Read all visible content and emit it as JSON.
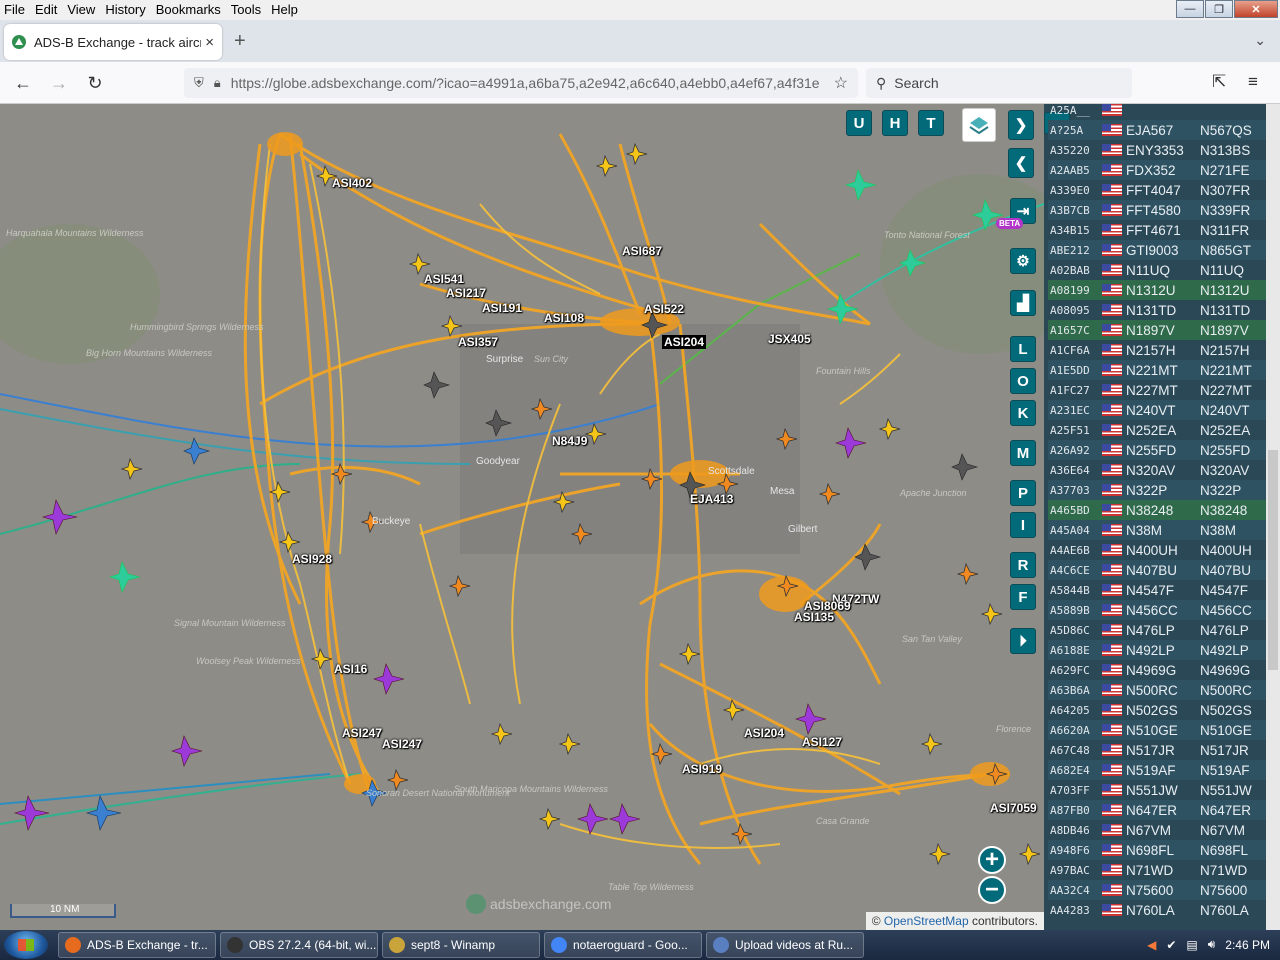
{
  "menubar": {
    "items": [
      "File",
      "Edit",
      "View",
      "History",
      "Bookmarks",
      "Tools",
      "Help"
    ]
  },
  "tab": {
    "title": "ADS-B Exchange - track aircraft",
    "close": "×"
  },
  "newtab": "+",
  "url": "https://globe.adsbexchange.com/?icao=a4991a,a6ba75,a2e942,a6c640,a4ebb0,a4ef67,a4f31e",
  "search_placeholder": "Search",
  "map": {
    "buttons": [
      "U",
      "H",
      "T",
      "L",
      "O",
      "K",
      "M",
      "P",
      "I",
      "R",
      "F"
    ],
    "beta": "BETA",
    "scale": "10 NM",
    "watermark": "adsbexchange.com",
    "attribution_prefix": "© ",
    "attribution_link": "OpenStreetMap",
    "attribution_suffix": " contributors.",
    "labels": [
      {
        "text": "ASI402"
      },
      {
        "text": "ASI541"
      },
      {
        "text": "ASI217"
      },
      {
        "text": "ASI191"
      },
      {
        "text": "ASI108"
      },
      {
        "text": "ASI687"
      },
      {
        "text": "ASI522"
      },
      {
        "text": "ASI357"
      },
      {
        "text": "ASI204"
      },
      {
        "text": "JSX405"
      },
      {
        "text": "N84J9"
      },
      {
        "text": "EJA413"
      },
      {
        "text": "ASI928"
      },
      {
        "text": "N472TW"
      },
      {
        "text": "ASI8069"
      },
      {
        "text": "ASI135"
      },
      {
        "text": "ASI16"
      },
      {
        "text": "ASI247"
      },
      {
        "text": "ASI247"
      },
      {
        "text": "ASI204"
      },
      {
        "text": "ASI127"
      },
      {
        "text": "ASI919"
      },
      {
        "text": "ASI7059"
      }
    ],
    "places": [
      {
        "text": "Harquahala Mountains Wilderness"
      },
      {
        "text": "Tonto National Forest"
      },
      {
        "text": "Surprise"
      },
      {
        "text": "Sun City"
      },
      {
        "text": "Goodyear"
      },
      {
        "text": "Buckeye"
      },
      {
        "text": "Scottsdale"
      },
      {
        "text": "Mesa"
      },
      {
        "text": "Gilbert"
      },
      {
        "text": "Fountain Hills"
      },
      {
        "text": "Apache Junction"
      },
      {
        "text": "San Tan Valley"
      },
      {
        "text": "Woolsey Peak Wilderness"
      },
      {
        "text": "Sonoran Desert National Monument"
      },
      {
        "text": "South Maricopa Mountains Wilderness"
      },
      {
        "text": "Florence"
      },
      {
        "text": "Table Top Wilderness"
      },
      {
        "text": "Casa Grande"
      },
      {
        "text": "Hummingbird Springs Wilderness"
      },
      {
        "text": "Signal Mountain Wilderness"
      },
      {
        "text": "Big Horn Mountains Wilderness"
      }
    ]
  },
  "aircraft_list": [
    {
      "hex": "A25A__",
      "callsign": "",
      "reg": ""
    },
    {
      "hex": "A?25A",
      "callsign": "EJA567",
      "reg": "N567QS"
    },
    {
      "hex": "A35220",
      "callsign": "ENY3353",
      "reg": "N313BS"
    },
    {
      "hex": "A2AAB5",
      "callsign": "FDX352",
      "reg": "N271FE"
    },
    {
      "hex": "A339E0",
      "callsign": "FFT4047",
      "reg": "N307FR"
    },
    {
      "hex": "A3B7CB",
      "callsign": "FFT4580",
      "reg": "N339FR"
    },
    {
      "hex": "A34B15",
      "callsign": "FFT4671",
      "reg": "N311FR"
    },
    {
      "hex": "ABE212",
      "callsign": "GTI9003",
      "reg": "N865GT"
    },
    {
      "hex": "A02BAB",
      "callsign": "N11UQ",
      "reg": "N11UQ"
    },
    {
      "hex": "A08199",
      "callsign": "N1312U",
      "reg": "N1312U",
      "hl": true
    },
    {
      "hex": "A08095",
      "callsign": "N131TD",
      "reg": "N131TD"
    },
    {
      "hex": "A1657C",
      "callsign": "N1897V",
      "reg": "N1897V",
      "hl": true
    },
    {
      "hex": "A1CF6A",
      "callsign": "N2157H",
      "reg": "N2157H"
    },
    {
      "hex": "A1E5DD",
      "callsign": "N221MT",
      "reg": "N221MT"
    },
    {
      "hex": "A1FC27",
      "callsign": "N227MT",
      "reg": "N227MT"
    },
    {
      "hex": "A231EC",
      "callsign": "N240VT",
      "reg": "N240VT"
    },
    {
      "hex": "A25F51",
      "callsign": "N252EA",
      "reg": "N252EA"
    },
    {
      "hex": "A26A92",
      "callsign": "N255FD",
      "reg": "N255FD"
    },
    {
      "hex": "A36E64",
      "callsign": "N320AV",
      "reg": "N320AV"
    },
    {
      "hex": "A37703",
      "callsign": "N322P",
      "reg": "N322P"
    },
    {
      "hex": "A465BD",
      "callsign": "N38248",
      "reg": "N38248",
      "hl": true
    },
    {
      "hex": "A45A04",
      "callsign": "N38M",
      "reg": "N38M"
    },
    {
      "hex": "A4AE6B",
      "callsign": "N400UH",
      "reg": "N400UH"
    },
    {
      "hex": "A4C6CE",
      "callsign": "N407BU",
      "reg": "N407BU"
    },
    {
      "hex": "A5844B",
      "callsign": "N4547F",
      "reg": "N4547F"
    },
    {
      "hex": "A5889B",
      "callsign": "N456CC",
      "reg": "N456CC"
    },
    {
      "hex": "A5D86C",
      "callsign": "N476LP",
      "reg": "N476LP"
    },
    {
      "hex": "A6188E",
      "callsign": "N492LP",
      "reg": "N492LP"
    },
    {
      "hex": "A629FC",
      "callsign": "N4969G",
      "reg": "N4969G"
    },
    {
      "hex": "A63B6A",
      "callsign": "N500RC",
      "reg": "N500RC"
    },
    {
      "hex": "A64205",
      "callsign": "N502GS",
      "reg": "N502GS"
    },
    {
      "hex": "A6620A",
      "callsign": "N510GE",
      "reg": "N510GE"
    },
    {
      "hex": "A67C48",
      "callsign": "N517JR",
      "reg": "N517JR"
    },
    {
      "hex": "A682E4",
      "callsign": "N519AF",
      "reg": "N519AF"
    },
    {
      "hex": "A703FF",
      "callsign": "N551JW",
      "reg": "N551JW"
    },
    {
      "hex": "A87FB0",
      "callsign": "N647ER",
      "reg": "N647ER"
    },
    {
      "hex": "A8DB46",
      "callsign": "N67VM",
      "reg": "N67VM"
    },
    {
      "hex": "A948F6",
      "callsign": "N698FL",
      "reg": "N698FL"
    },
    {
      "hex": "A97BAC",
      "callsign": "N71WD",
      "reg": "N71WD"
    },
    {
      "hex": "AA32C4",
      "callsign": "N75600",
      "reg": "N75600"
    },
    {
      "hex": "AA4283",
      "callsign": "N760LA",
      "reg": "N760LA"
    }
  ],
  "taskbar": {
    "items": [
      {
        "label": "ADS-B Exchange - tr...",
        "color": "#e66b1f"
      },
      {
        "label": "OBS 27.2.4 (64-bit, wi...",
        "color": "#333333"
      },
      {
        "label": "sept8 - Winamp",
        "color": "#c9a43a"
      },
      {
        "label": "notaeroguard - Goo...",
        "color": "#4285f4"
      },
      {
        "label": "Upload videos at Ru...",
        "color": "#5a7fc0"
      }
    ],
    "clock": "2:46 PM"
  },
  "colors": {
    "trail": "#f5a623",
    "trail_alt": "#f7c13a",
    "map_bg": "#8a8a86",
    "panel": "#2b4857"
  }
}
